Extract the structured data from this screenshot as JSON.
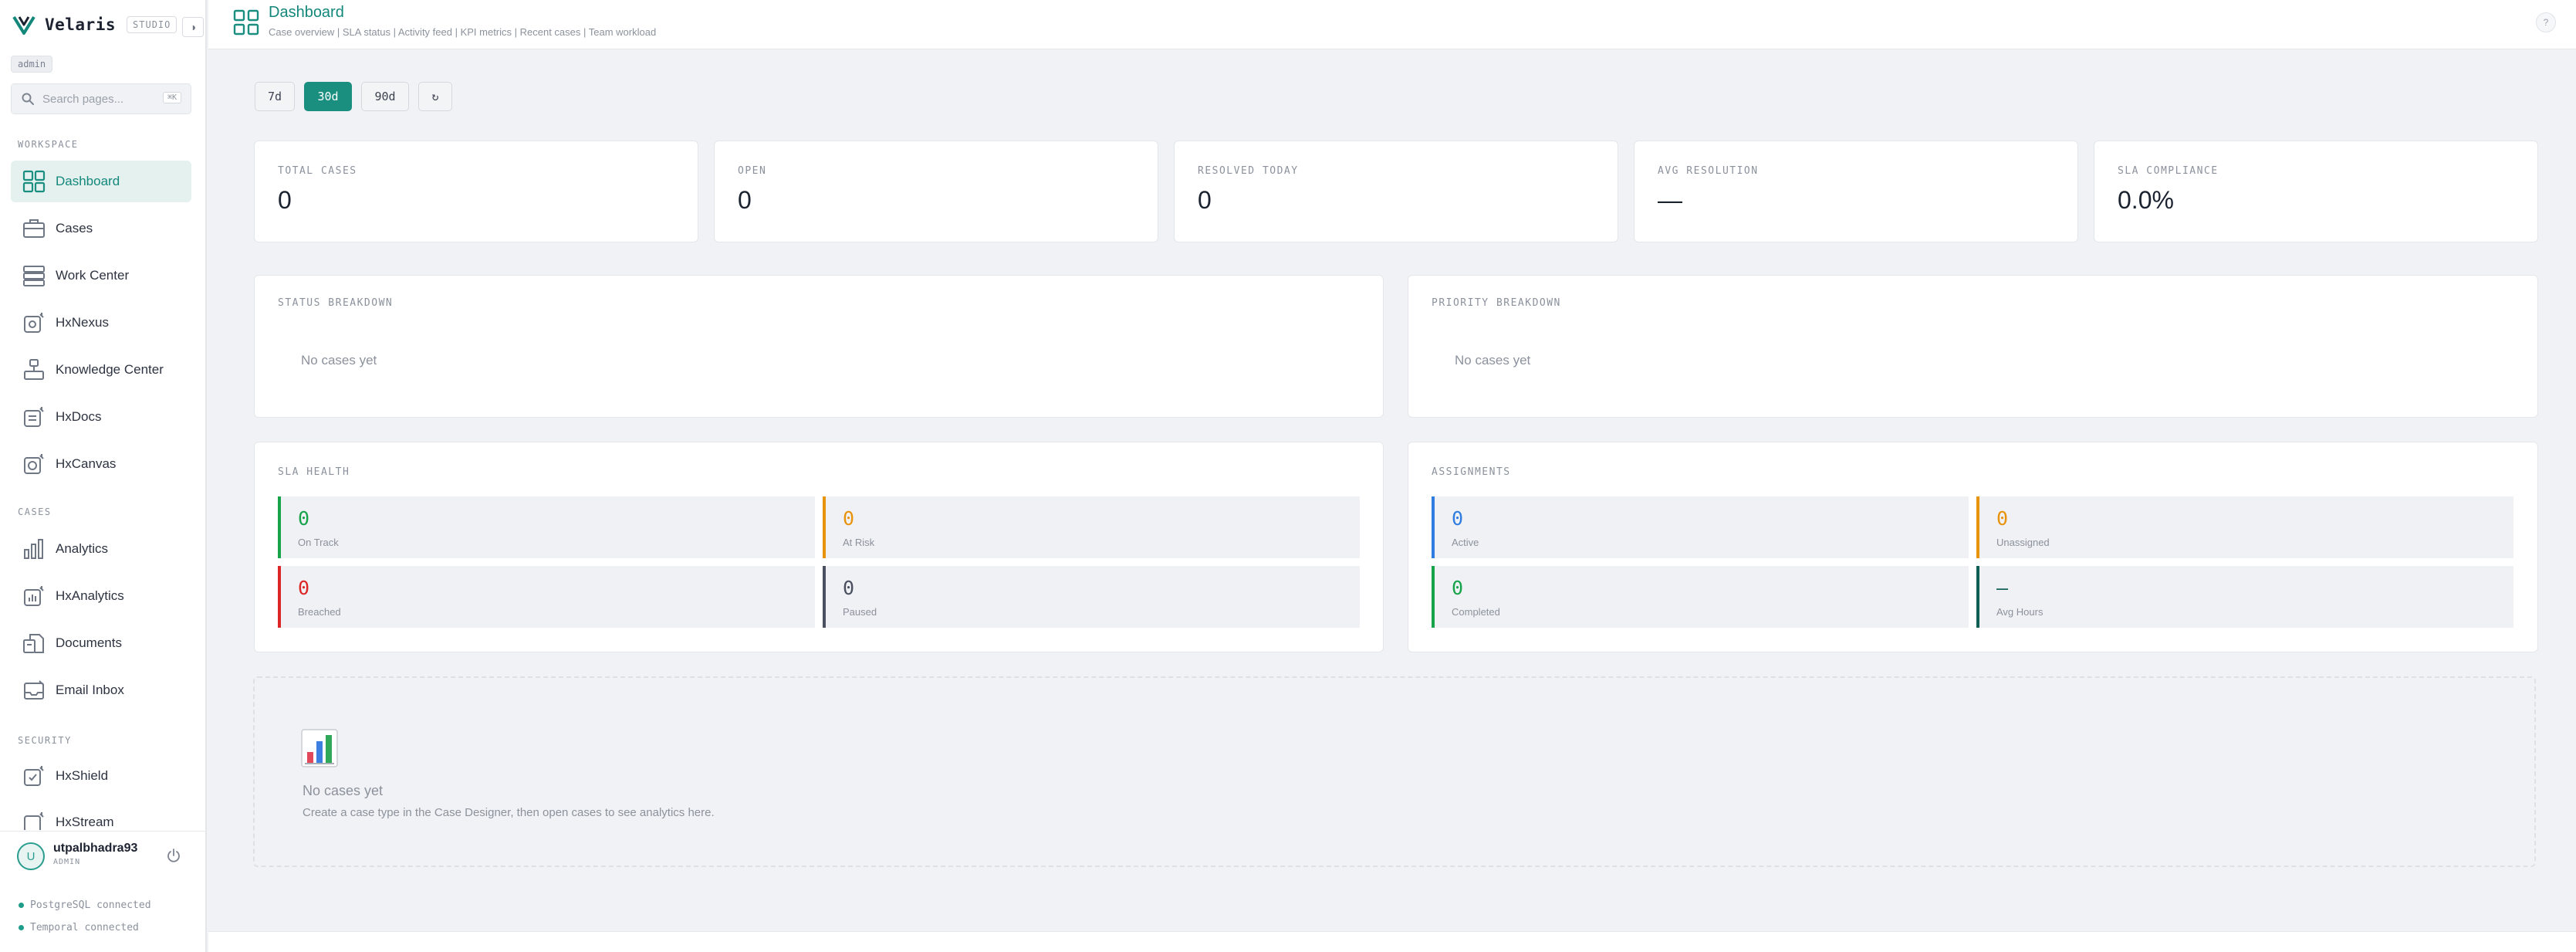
{
  "brand": {
    "name": "Velaris",
    "badge": "STUDIO",
    "theme_toggle": "◑"
  },
  "sidebar": {
    "role": "admin",
    "search": {
      "placeholder": "Search pages...",
      "shortcut": "⌘K"
    },
    "sections": {
      "workspace": "WORKSPACE",
      "cases": "CASES",
      "security": "SECURITY"
    },
    "workspace_items": [
      {
        "label": "Dashboard",
        "icon": "dashboard-grid-icon",
        "active": true
      },
      {
        "label": "Cases",
        "icon": "briefcase-icon"
      },
      {
        "label": "Work Center",
        "icon": "server-stack-icon"
      },
      {
        "label": "HxNexus",
        "icon": "hx-module-icon"
      },
      {
        "label": "Knowledge Center",
        "icon": "knowledge-tree-icon"
      },
      {
        "label": "HxDocs",
        "icon": "hx-docs-icon"
      },
      {
        "label": "HxCanvas",
        "icon": "hx-canvas-icon"
      }
    ],
    "cases_items": [
      {
        "label": "Analytics",
        "icon": "bar-chart-icon"
      },
      {
        "label": "HxAnalytics",
        "icon": "hx-analytics-icon"
      },
      {
        "label": "Documents",
        "icon": "documents-icon"
      },
      {
        "label": "Email Inbox",
        "icon": "email-inbox-icon"
      }
    ],
    "security_items": [
      {
        "label": "HxShield",
        "icon": "hx-shield-icon"
      },
      {
        "label": "HxStream",
        "icon": "hx-stream-icon"
      }
    ],
    "user": {
      "initial": "U",
      "name": "utpalbhadra93",
      "role": "ADMIN"
    },
    "status": [
      {
        "label": "PostgreSQL connected"
      },
      {
        "label": "Temporal connected"
      }
    ]
  },
  "header": {
    "title": "Dashboard",
    "subtitle": "Case overview | SLA status | Activity feed | KPI metrics | Recent cases | Team workload",
    "help": "?"
  },
  "range": {
    "options": [
      "7d",
      "30d",
      "90d"
    ],
    "selected": "30d",
    "refresh": "↻"
  },
  "kpis": [
    {
      "label": "TOTAL CASES",
      "value": "0"
    },
    {
      "label": "OPEN",
      "value": "0"
    },
    {
      "label": "RESOLVED TODAY",
      "value": "0"
    },
    {
      "label": "AVG RESOLUTION",
      "value": "—"
    },
    {
      "label": "SLA COMPLIANCE",
      "value": "0.0%"
    }
  ],
  "status_breakdown": {
    "title": "STATUS BREAKDOWN",
    "empty": "No cases yet"
  },
  "priority_breakdown": {
    "title": "PRIORITY BREAKDOWN",
    "empty": "No cases yet"
  },
  "sla_health": {
    "title": "SLA HEALTH",
    "stats": [
      {
        "value": "0",
        "label": "On Track",
        "color": "#16a34a"
      },
      {
        "value": "0",
        "label": "At Risk",
        "color": "#e8930c"
      },
      {
        "value": "0",
        "label": "Breached",
        "color": "#dc2626"
      },
      {
        "value": "0",
        "label": "Paused",
        "color": "#4b5060"
      }
    ]
  },
  "assignments": {
    "title": "ASSIGNMENTS",
    "stats": [
      {
        "value": "0",
        "label": "Active",
        "color": "#2f7de1"
      },
      {
        "value": "0",
        "label": "Unassigned",
        "color": "#e8930c"
      },
      {
        "value": "0",
        "label": "Completed",
        "color": "#16a34a"
      },
      {
        "value": "—",
        "label": "Avg Hours",
        "color": "#0f5f55"
      }
    ]
  },
  "empty_state": {
    "icon": "bar-chart-emoji-icon",
    "title": "No cases yet",
    "subtitle": "Create a case type in the Case Designer, then open cases to see analytics here."
  },
  "colors": {
    "accent": "#1a8f80",
    "accent_text": "#12877a",
    "background": "#f1f2f5"
  }
}
